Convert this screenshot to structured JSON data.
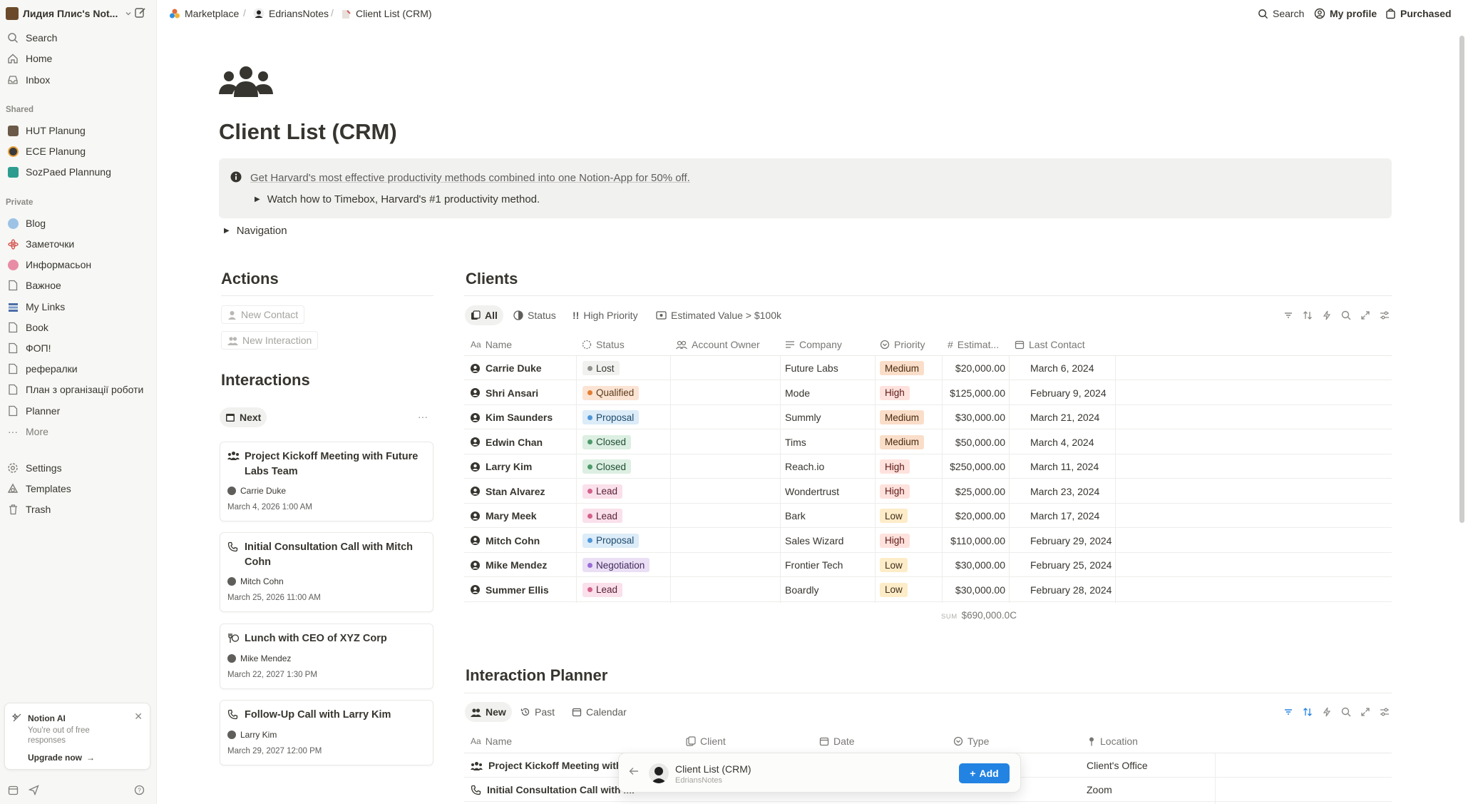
{
  "sidebar": {
    "workspace": "Лидия Плис's Not...",
    "items": [
      {
        "label": "Search",
        "icon": "search-icon"
      },
      {
        "label": "Home",
        "icon": "home-icon"
      },
      {
        "label": "Inbox",
        "icon": "inbox-icon"
      }
    ],
    "shared_label": "Shared",
    "shared": [
      "HUT Planung",
      "ECE Planung",
      "SozPaed Plannung"
    ],
    "private_label": "Private",
    "private": [
      "Blog",
      "Заметочки",
      "Информасьон",
      "Важное",
      "My Links",
      "Book",
      "ФОП!",
      "рефералки",
      "План з організації роботи",
      "Planner",
      "More"
    ],
    "footer": [
      "Settings",
      "Templates",
      "Trash"
    ],
    "ai": {
      "title": "Notion AI",
      "sub": "You're out of free responses",
      "cta": "Upgrade now"
    }
  },
  "breadcrumb": [
    "Marketplace",
    "EdriansNotes",
    "Client List (CRM)"
  ],
  "sep": "/",
  "topbar": {
    "search": "Search",
    "profile": "My profile",
    "purchased": "Purchased"
  },
  "page": {
    "title": "Client List (CRM)",
    "callout_link": "Get Harvard's most effective productivity methods combined into one Notion-App for 50% off.",
    "callout_toggle": "Watch how to Timebox, Harvard's #1 productivity method.",
    "navigation": "Navigation"
  },
  "actions": {
    "title": "Actions",
    "buttons": [
      "New Contact",
      "New Interaction"
    ]
  },
  "interactions": {
    "title": "Interactions",
    "view": "Next",
    "more": "···",
    "cards": [
      {
        "title": "Project Kickoff Meeting with Future Labs Team",
        "person": "Carrie Duke",
        "date": "March 4, 2026 1:00 AM"
      },
      {
        "title": "Initial Consultation Call with Mitch Cohn",
        "person": "Mitch Cohn",
        "date": "March 25, 2026 11:00 AM"
      },
      {
        "title": "Lunch with CEO of XYZ Corp",
        "person": "Mike Mendez",
        "date": "March 22, 2027 1:30 PM"
      },
      {
        "title": "Follow-Up Call with Larry Kim",
        "person": "Larry Kim",
        "date": "March 29, 2027 12:00 PM"
      }
    ]
  },
  "clients": {
    "title": "Clients",
    "views": [
      "All",
      "Status",
      "High Priority",
      "Estimated Value > $100k"
    ],
    "columns": [
      "Name",
      "Status",
      "Account Owner",
      "Company",
      "Priority",
      "Estimat...",
      "Last Contact"
    ],
    "rows": [
      {
        "name": "Carrie Duke",
        "status": "Lost",
        "company": "Future Labs",
        "priority": "Medium",
        "value": "$20,000.00",
        "last": "March 6, 2024"
      },
      {
        "name": "Shri Ansari",
        "status": "Qualified",
        "company": "Mode",
        "priority": "High",
        "value": "$125,000.00",
        "last": "February 9, 2024"
      },
      {
        "name": "Kim Saunders",
        "status": "Proposal",
        "company": "Summly",
        "priority": "Medium",
        "value": "$30,000.00",
        "last": "March 21, 2024"
      },
      {
        "name": "Edwin Chan",
        "status": "Closed",
        "company": "Tims",
        "priority": "Medium",
        "value": "$50,000.00",
        "last": "March 4, 2024"
      },
      {
        "name": "Larry Kim",
        "status": "Closed",
        "company": "Reach.io",
        "priority": "High",
        "value": "$250,000.00",
        "last": "March 11, 2024"
      },
      {
        "name": "Stan Alvarez",
        "status": "Lead",
        "company": "Wondertrust",
        "priority": "High",
        "value": "$25,000.00",
        "last": "March 23, 2024"
      },
      {
        "name": "Mary Meek",
        "status": "Lead",
        "company": "Bark",
        "priority": "Low",
        "value": "$20,000.00",
        "last": "March 17, 2024"
      },
      {
        "name": "Mitch Cohn",
        "status": "Proposal",
        "company": "Sales Wizard",
        "priority": "High",
        "value": "$110,000.00",
        "last": "February 29, 2024"
      },
      {
        "name": "Mike Mendez",
        "status": "Negotiation",
        "company": "Frontier Tech",
        "priority": "Low",
        "value": "$30,000.00",
        "last": "February 25, 2024"
      },
      {
        "name": "Summer Ellis",
        "status": "Lead",
        "company": "Boardly",
        "priority": "Low",
        "value": "$30,000.00",
        "last": "February 28, 2024"
      }
    ],
    "sum_label": "SUM",
    "sum_value": "$690,000.0C"
  },
  "planner": {
    "title": "Interaction Planner",
    "views": [
      "New",
      "Past",
      "Calendar"
    ],
    "columns": [
      "Name",
      "Client",
      "Date",
      "Type",
      "Location"
    ],
    "rows": [
      {
        "name": "Project Kickoff Meeting with Fu",
        "location": "Client's Office"
      },
      {
        "name": "Initial Consultation Call with Mi",
        "location": "Zoom"
      }
    ]
  },
  "float_bar": {
    "title": "Client List (CRM)",
    "sub": "EdriansNotes",
    "add": "Add"
  },
  "colors": {
    "status": {
      "Lost": {
        "bg": "#f1f1ef",
        "fg": "#37352f",
        "dot": "#91918e"
      },
      "Qualified": {
        "bg": "#fbe4d3",
        "fg": "#5c3a1c",
        "dot": "#e27d33"
      },
      "Proposal": {
        "bg": "#dcecf8",
        "fg": "#1f4b6e",
        "dot": "#4f97d8"
      },
      "Closed": {
        "bg": "#dcefe2",
        "fg": "#1f4d32",
        "dot": "#4e9a6b"
      },
      "Lead": {
        "bg": "#fae0ea",
        "fg": "#5a2137",
        "dot": "#d4608b"
      },
      "Negotiation": {
        "bg": "#eadff5",
        "fg": "#43295c",
        "dot": "#9a6dd7"
      }
    },
    "priority": {
      "Medium": {
        "bg": "#fadec9",
        "fg": "#49290e"
      },
      "High": {
        "bg": "#ffe2dd",
        "fg": "#5d1715"
      },
      "Low": {
        "bg": "#fdecc8",
        "fg": "#402c1b"
      }
    },
    "accent": "#2383e2"
  }
}
